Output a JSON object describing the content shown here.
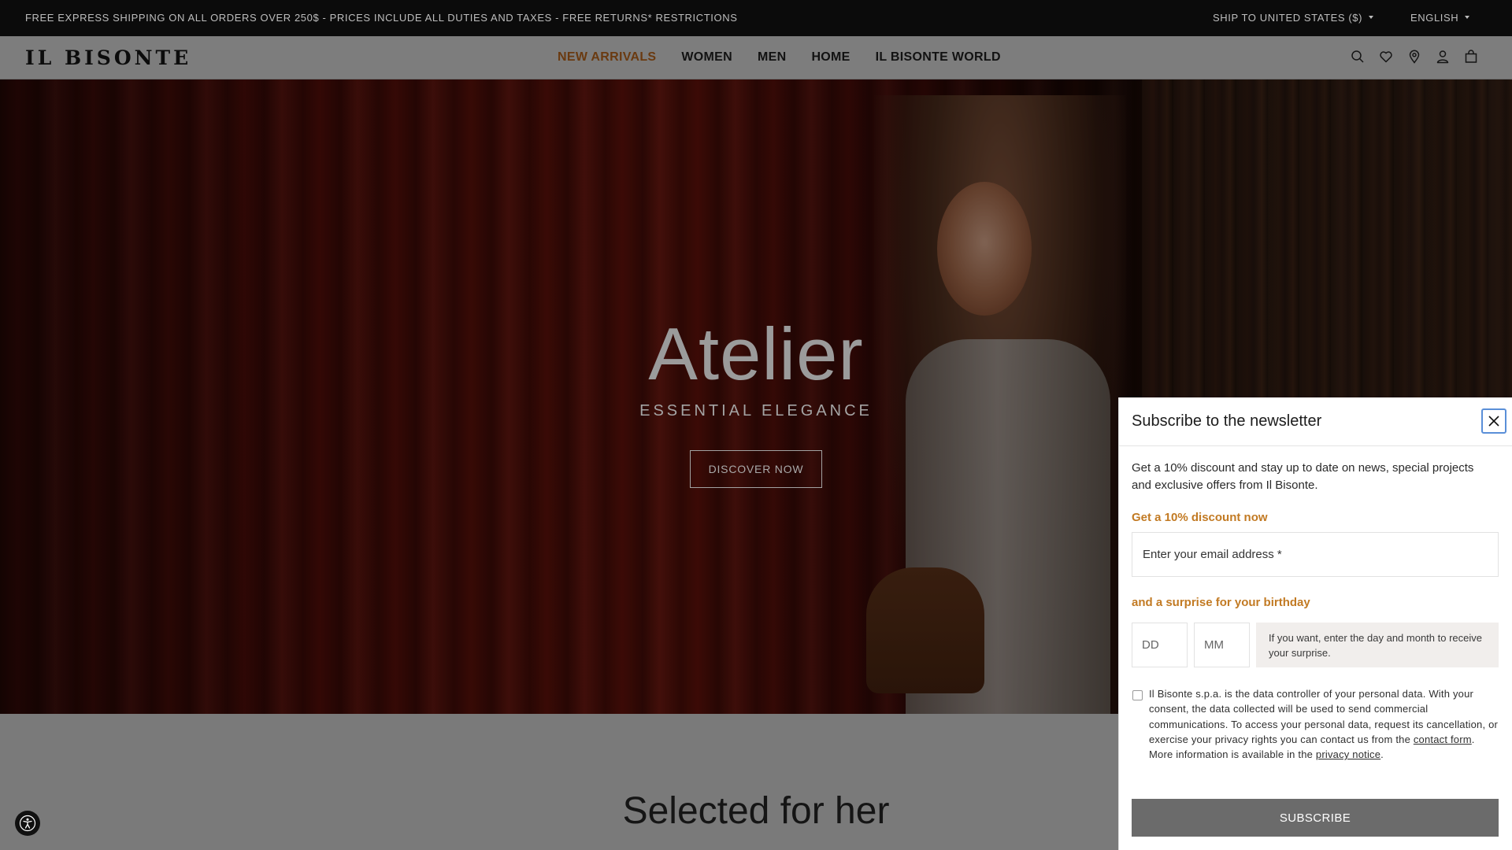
{
  "topbar": {
    "promo": "FREE EXPRESS SHIPPING ON ALL ORDERS OVER 250$ - PRICES INCLUDE ALL DUTIES AND TAXES - FREE RETURNS* RESTRICTIONS",
    "ship_to": "SHIP TO UNITED STATES ($)",
    "language": "ENGLISH"
  },
  "header": {
    "logo": "IL BISONTE",
    "nav": [
      {
        "label": "NEW ARRIVALS",
        "active": true
      },
      {
        "label": "WOMEN",
        "active": false
      },
      {
        "label": "MEN",
        "active": false
      },
      {
        "label": "HOME",
        "active": false
      },
      {
        "label": "IL BISONTE WORLD",
        "active": false
      }
    ],
    "icons": [
      "search-icon",
      "heart-icon",
      "location-pin-icon",
      "user-icon",
      "bag-icon"
    ]
  },
  "hero": {
    "title": "Atelier",
    "subtitle": "ESSENTIAL ELEGANCE",
    "cta": "DISCOVER NOW"
  },
  "section": {
    "title": "Selected for her"
  },
  "newsletter": {
    "title": "Subscribe to the newsletter",
    "intro": "Get a 10% discount and stay up to date on news, special projects and exclusive offers from Il Bisonte.",
    "discount_label": "Get a 10% discount now",
    "email_placeholder": "Enter your email address *",
    "birthday_label": "and a surprise for your birthday",
    "day_placeholder": "DD",
    "month_placeholder": "MM",
    "birthday_hint": "If you want, enter the day and month to receive your surprise.",
    "consent_part1": "Il Bisonte s.p.a. is the data controller of your personal data. With your consent, the data collected will be used to send commercial communications. To access your personal data, request its cancellation, or exercise your privacy rights you can contact us from the ",
    "consent_link1": "contact form",
    "consent_part2": ". More information is available in the ",
    "consent_link2": "privacy notice",
    "consent_part3": ".",
    "subscribe_label": "SUBSCRIBE"
  },
  "colors": {
    "accent_orange": "#c27a23",
    "nav_active": "#6a3a10",
    "subscribe_bg": "#6b6b6b",
    "topbar_bg": "#0b0b0b"
  }
}
